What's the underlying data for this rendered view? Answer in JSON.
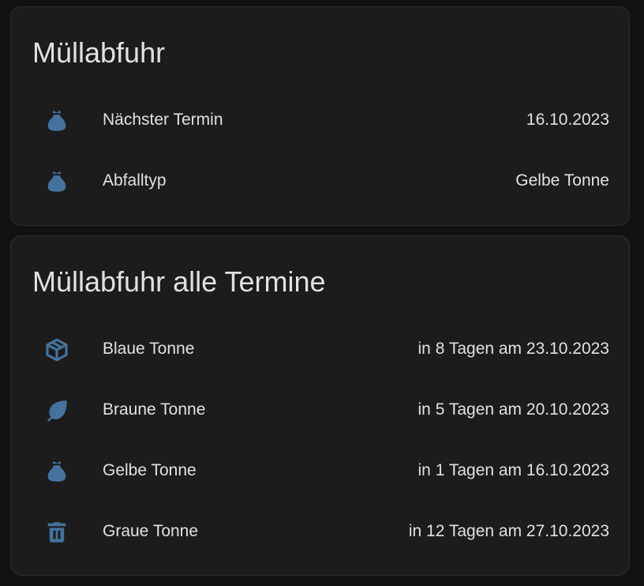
{
  "colors": {
    "background": "#111111",
    "card": "#1c1c1c",
    "icon": "#44739e",
    "text": "#e1e1e1"
  },
  "card_next": {
    "title": "Müllabfuhr",
    "rows": [
      {
        "icon": "sack-icon",
        "label": "Nächster Termin",
        "value": "16.10.2023"
      },
      {
        "icon": "sack-icon",
        "label": "Abfalltyp",
        "value": "Gelbe Tonne"
      }
    ]
  },
  "card_all": {
    "title": "Müllabfuhr alle Termine",
    "rows": [
      {
        "icon": "package-variant-icon",
        "label": "Blaue Tonne",
        "value": "in 8 Tagen am 23.10.2023"
      },
      {
        "icon": "leaf-icon",
        "label": "Braune Tonne",
        "value": "in 5 Tagen am 20.10.2023"
      },
      {
        "icon": "sack-icon",
        "label": "Gelbe Tonne",
        "value": "in 1 Tagen am 16.10.2023"
      },
      {
        "icon": "trash-can-icon",
        "label": "Graue Tonne",
        "value": "in 12 Tagen am 27.10.2023"
      }
    ]
  }
}
